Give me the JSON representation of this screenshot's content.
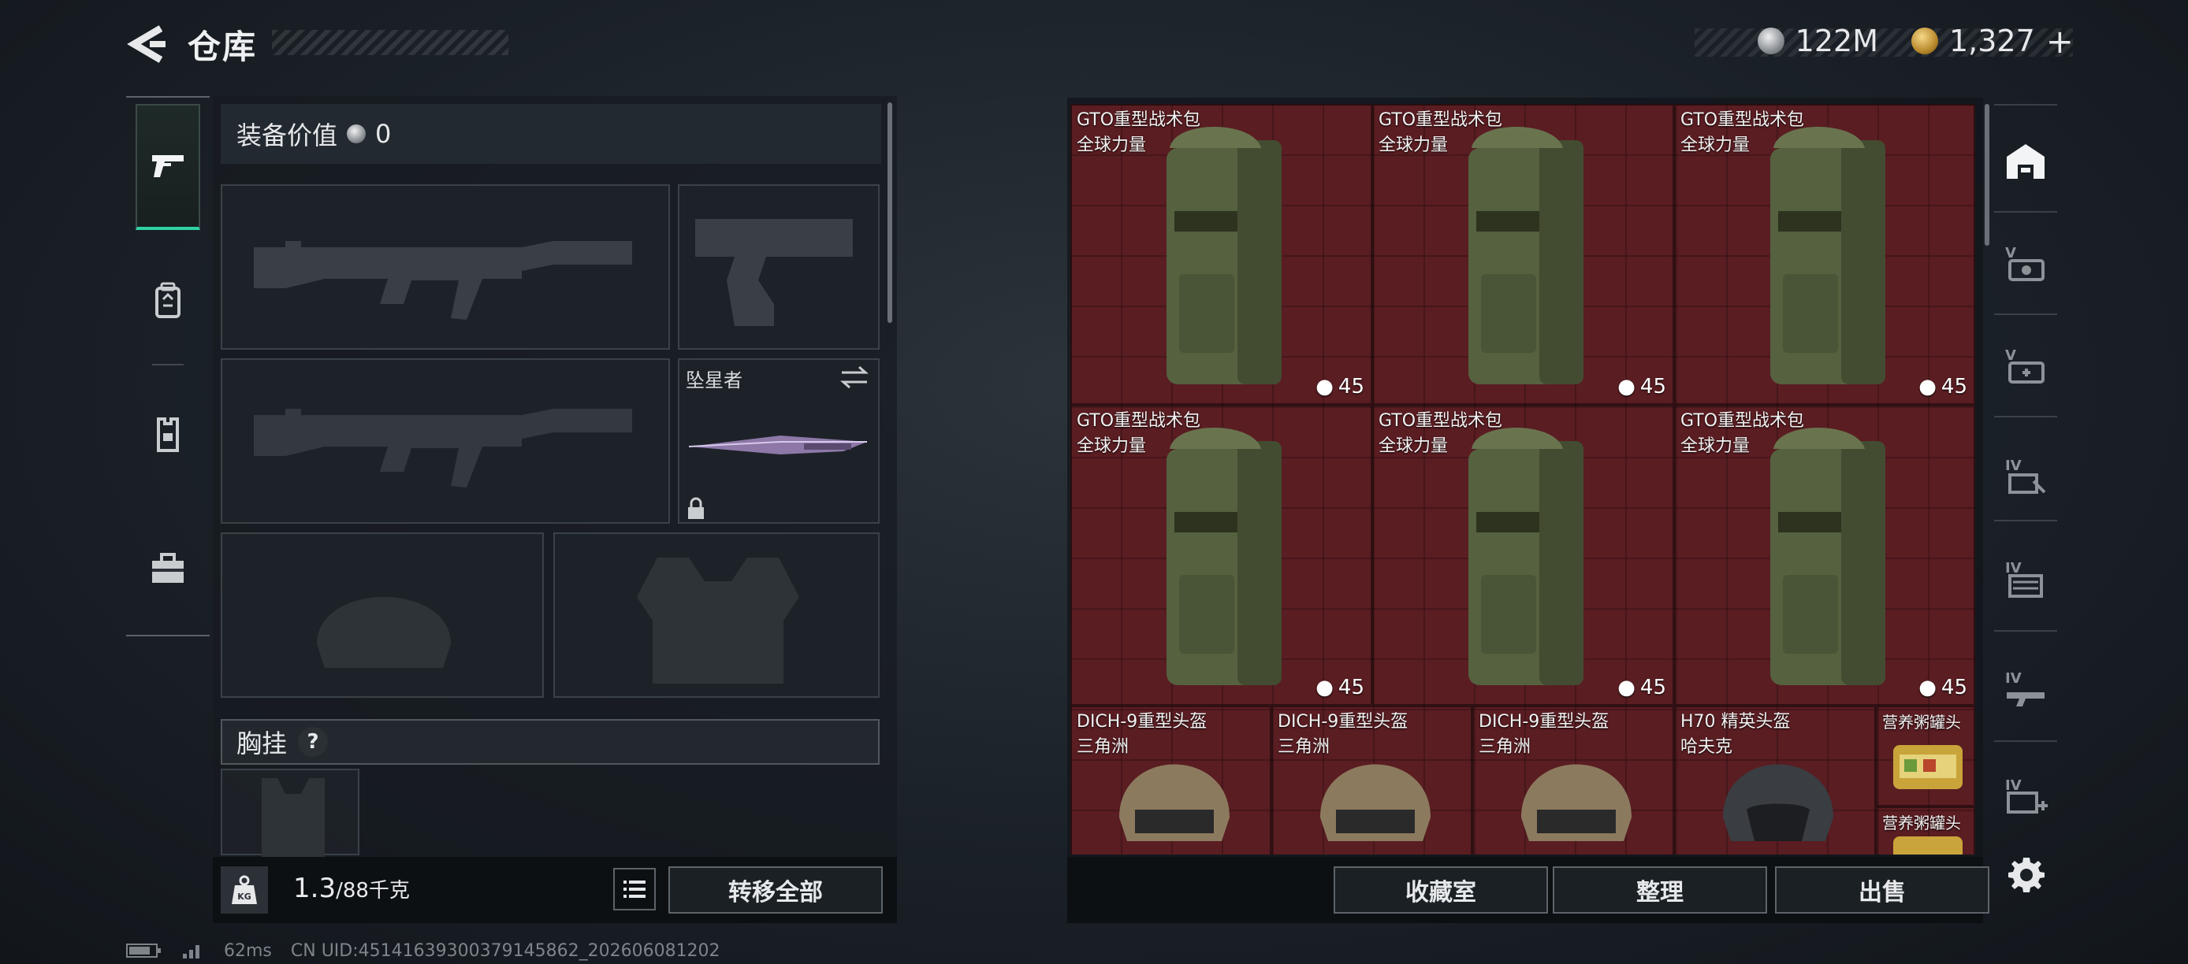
{
  "header": {
    "title": "仓库",
    "currency_silver": "122M",
    "currency_gold": "1,327",
    "currency_add": "+"
  },
  "sidebar": {
    "tabs": [
      {
        "icon": "pistol-icon",
        "active": true
      },
      {
        "icon": "backpack-icon",
        "active": false
      },
      {
        "icon": "vest-icon",
        "active": false
      },
      {
        "icon": "toolbox-icon",
        "active": false
      }
    ]
  },
  "loadout": {
    "equip_value_label": "装备价值",
    "equip_value": "0",
    "melee_name": "坠星者",
    "rig_label": "胸挂",
    "rig_help": "?",
    "weight_current": "1.3",
    "weight_max": "/88千克",
    "weight_icon_text": "KG",
    "transfer_all": "转移全部"
  },
  "stash": {
    "backpacks": [
      {
        "name": "GTO重型战术包",
        "sub": "全球力量",
        "capacity": "45"
      },
      {
        "name": "GTO重型战术包",
        "sub": "全球力量",
        "capacity": "45"
      },
      {
        "name": "GTO重型战术包",
        "sub": "全球力量",
        "capacity": "45"
      },
      {
        "name": "GTO重型战术包",
        "sub": "全球力量",
        "capacity": "45"
      },
      {
        "name": "GTO重型战术包",
        "sub": "全球力量",
        "capacity": "45"
      },
      {
        "name": "GTO重型战术包",
        "sub": "全球力量",
        "capacity": "45"
      }
    ],
    "helmets": [
      {
        "name": "DICH-9重型头盔",
        "sub": "三角洲"
      },
      {
        "name": "DICH-9重型头盔",
        "sub": "三角洲"
      },
      {
        "name": "DICH-9重型头盔",
        "sub": "三角洲"
      },
      {
        "name": "H70 精英头盔",
        "sub": "哈夫克"
      }
    ],
    "food": [
      {
        "name": "营养粥罐头"
      },
      {
        "name": "营养粥罐头"
      }
    ]
  },
  "right_tabs": [
    {
      "icon": "stash-icon"
    },
    {
      "icon": "tier-v-ammo-icon",
      "tier": "V"
    },
    {
      "icon": "tier-v-medical-icon",
      "tier": "V"
    },
    {
      "icon": "tier-iv-tools-icon",
      "tier": "IV"
    },
    {
      "icon": "tier-iv-storage-icon",
      "tier": "IV"
    },
    {
      "icon": "tier-iv-weapons-icon",
      "tier": "IV"
    },
    {
      "icon": "tier-iv-add-icon",
      "tier": "IV"
    }
  ],
  "actions": {
    "collection": "收藏室",
    "sort": "整理",
    "sell": "出售"
  },
  "footer": {
    "ping": "62ms",
    "uid": "CN UID:4514163930037914586​2_202606081202"
  },
  "colors": {
    "accent": "#2ed3a3",
    "grid_bg": "#5a1d22",
    "panel_bg": "#161b20"
  }
}
